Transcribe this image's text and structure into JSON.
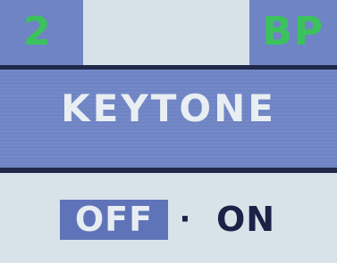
{
  "status_bar": {
    "page_number": "2",
    "mode_code": "BP"
  },
  "menu": {
    "title": "KEYTONE"
  },
  "options": {
    "off_label": "OFF",
    "separator": "·",
    "on_label": "ON",
    "selected": "OFF"
  },
  "colors": {
    "panel_blue": "#6f84c4",
    "status_green": "#3cc25c",
    "selected_bg": "#5f74b8",
    "text_dark": "#1b2247",
    "background": "#d8e3e9"
  }
}
